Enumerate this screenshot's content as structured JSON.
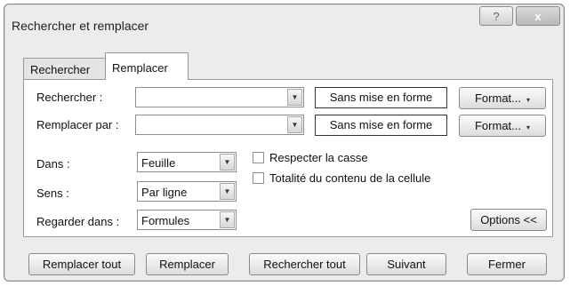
{
  "window": {
    "title": "Rechercher et remplacer",
    "help_glyph": "?",
    "close_glyph": "x"
  },
  "tabs": [
    {
      "label": "Rechercher",
      "active": false
    },
    {
      "label": "Remplacer",
      "active": true
    }
  ],
  "find": {
    "label": "Rechercher :",
    "value": "",
    "preview": "Sans mise en forme",
    "format_label": "Format..."
  },
  "replace": {
    "label": "Remplacer par :",
    "value": "",
    "preview": "Sans mise en forme",
    "format_label": "Format..."
  },
  "options": {
    "within_label": "Dans :",
    "within_value": "Feuille",
    "search_label": "Sens :",
    "search_value": "Par ligne",
    "lookin_label": "Regarder dans :",
    "lookin_value": "Formules",
    "match_case_label": "Respecter la casse",
    "match_case_checked": false,
    "entire_cell_label": "Totalité du contenu de la cellule",
    "entire_cell_checked": false,
    "options_button": "Options <<"
  },
  "footer": {
    "replace_all": "Remplacer tout",
    "replace": "Remplacer",
    "find_all": "Rechercher tout",
    "find_next": "Suivant",
    "close": "Fermer"
  },
  "icons": {
    "dropdown_arrow": "▼",
    "small_arrow": "▾"
  }
}
